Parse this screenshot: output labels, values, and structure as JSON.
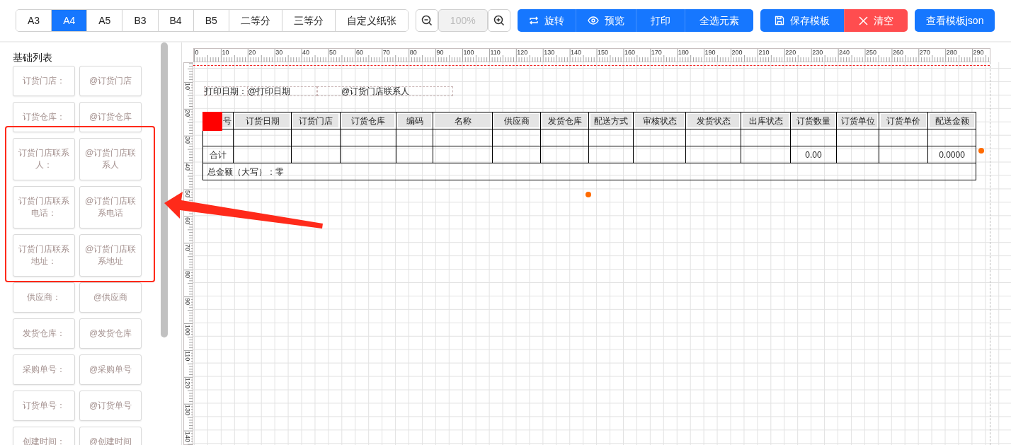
{
  "paper_sizes": [
    {
      "label": "A3",
      "selected": false
    },
    {
      "label": "A4",
      "selected": true
    },
    {
      "label": "A5",
      "selected": false
    },
    {
      "label": "B3",
      "selected": false
    },
    {
      "label": "B4",
      "selected": false
    },
    {
      "label": "B5",
      "selected": false
    },
    {
      "label": "二等分",
      "selected": false
    },
    {
      "label": "三等分",
      "selected": false
    },
    {
      "label": "自定义纸张",
      "selected": false
    }
  ],
  "zoom": {
    "value": "100%",
    "disabled": true
  },
  "actions": [
    {
      "label": "旋转",
      "kind": "rotate"
    },
    {
      "label": "预览",
      "kind": "preview"
    },
    {
      "label": "打印",
      "kind": "plain"
    },
    {
      "label": "全选元素",
      "kind": "plain"
    }
  ],
  "template_buttons": [
    {
      "label": "保存模板",
      "kind": "save"
    },
    {
      "label": "清空",
      "kind": "clear"
    }
  ],
  "json_button": {
    "label": "查看模板json"
  },
  "sidebar": {
    "title": "基础列表",
    "items": [
      {
        "label": "订货门店：",
        "value": "@订货门店"
      },
      {
        "label": "订货仓库：",
        "value": "@订货仓库"
      },
      {
        "label": "订货门店联系人：",
        "value": "@订货门店联系人"
      },
      {
        "label": "订货门店联系电话：",
        "value": "@订货门店联系电话"
      },
      {
        "label": "订货门店联系地址：",
        "value": "@订货门店联系地址"
      },
      {
        "label": "供应商：",
        "value": "@供应商"
      },
      {
        "label": "发货仓库：",
        "value": "@发货仓库"
      },
      {
        "label": "采购单号：",
        "value": "@采购单号"
      },
      {
        "label": "订货单号：",
        "value": "@订货单号"
      },
      {
        "label": "创建时间：",
        "value": "@创建时间"
      }
    ]
  },
  "canvas": {
    "ruler": {
      "x_labels": [
        "0",
        "10",
        "20",
        "30",
        "40",
        "50",
        "60",
        "70",
        "80",
        "90",
        "100",
        "110",
        "120",
        "130",
        "140",
        "150",
        "160",
        "170",
        "180",
        "190",
        "200",
        "210",
        "220",
        "230",
        "240",
        "250",
        "260",
        "270",
        "280",
        "290"
      ],
      "y_labels": [
        "10",
        "20",
        "30",
        "40",
        "50",
        "60",
        "70",
        "80",
        "90",
        "100",
        "110",
        "120",
        "130",
        "140"
      ]
    },
    "fields": [
      {
        "label": "打印日期：",
        "value": "@打印日期"
      },
      {
        "value": "@订货门店联系人"
      }
    ],
    "table": {
      "columns": [
        {
          "label": "号",
          "total": "合计"
        },
        {
          "label": "订货日期"
        },
        {
          "label": "订货门店"
        },
        {
          "label": "订货仓库"
        },
        {
          "label": "编码"
        },
        {
          "label": "名称"
        },
        {
          "label": "供应商"
        },
        {
          "label": "发货仓库"
        },
        {
          "label": "配送方式"
        },
        {
          "label": "审核状态"
        },
        {
          "label": "发货状态"
        },
        {
          "label": "出库状态"
        },
        {
          "label": "订货数量",
          "total": "0.00"
        },
        {
          "label": "订货单位"
        },
        {
          "label": "订货单价"
        },
        {
          "label": "配送金额",
          "total": "0.0000"
        }
      ],
      "rows": [
        {
          "kind": "blank"
        },
        {
          "kind": "total"
        }
      ],
      "summary": "总金额（大写）：零"
    }
  }
}
